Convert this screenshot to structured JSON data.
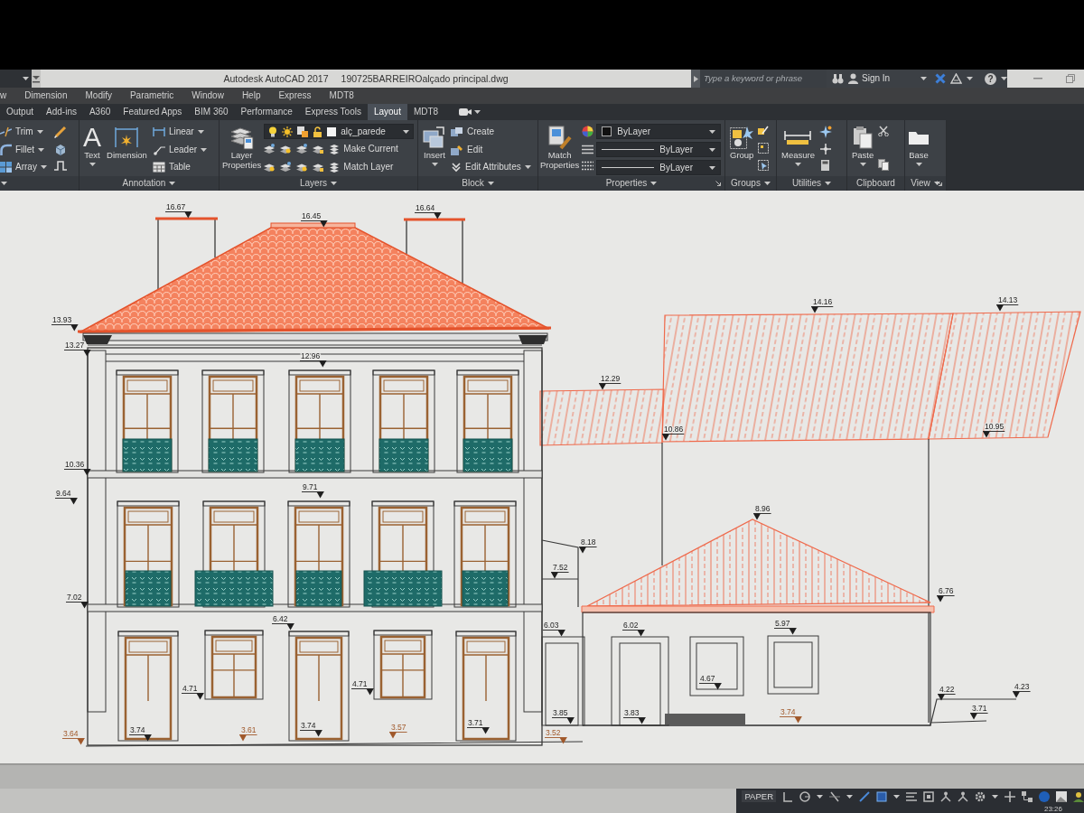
{
  "title_bar": {
    "title": "Autodesk AutoCAD 2017",
    "file_name": "190725BARREIROalçado principal.dwg",
    "search": {
      "placeholder": "Type a keyword or phrase"
    },
    "sign_in": "Sign In",
    "help_glyph": "?"
  },
  "menu_bar": [
    "w",
    "Dimension",
    "Modify",
    "Parametric",
    "Window",
    "Help",
    "Express",
    "MDT8"
  ],
  "ribbon_tabs": [
    {
      "label": "Output",
      "selected": false
    },
    {
      "label": "Add-ins",
      "selected": false
    },
    {
      "label": "A360",
      "selected": false
    },
    {
      "label": "Featured Apps",
      "selected": false
    },
    {
      "label": "BIM 360",
      "selected": false
    },
    {
      "label": "Performance",
      "selected": false
    },
    {
      "label": "Express Tools",
      "selected": false
    },
    {
      "label": "Layout",
      "selected": true
    },
    {
      "label": "MDT8",
      "selected": false
    }
  ],
  "ribbon_panels": [
    {
      "title_menu": true,
      "tools": [
        {
          "kind": "small",
          "label": "Trim",
          "has_menu": true
        },
        {
          "kind": "small",
          "label": "Fillet",
          "has_menu": true
        },
        {
          "kind": "small",
          "label": "Array",
          "has_menu": true
        }
      ]
    },
    {
      "title": "Annotation",
      "title_menu": true,
      "tools": [
        {
          "kind": "large",
          "glyph": "A",
          "label": "Text",
          "has_menu": true
        },
        {
          "kind": "large",
          "label": "Dimension",
          "has_menu": false
        },
        {
          "kind": "small",
          "label": "Linear",
          "has_menu": true
        },
        {
          "kind": "small",
          "label": "Leader",
          "has_menu": true
        },
        {
          "kind": "small",
          "label": "Table",
          "has_menu": false
        }
      ]
    },
    {
      "title": "Layers",
      "title_menu": true,
      "tools": [
        {
          "kind": "large",
          "label": "Layer Properties",
          "has_menu": false
        },
        {
          "kind": "layer_dropdown",
          "value": "alç_parede"
        },
        {
          "kind": "small",
          "label": "Make Current",
          "has_menu": false
        },
        {
          "kind": "small",
          "label": "Match Layer",
          "has_menu": false
        }
      ]
    },
    {
      "title": "Block",
      "title_menu": true,
      "tools": [
        {
          "kind": "large",
          "label": "Insert",
          "has_menu": true
        },
        {
          "kind": "small",
          "label": "Create",
          "has_menu": false
        },
        {
          "kind": "small",
          "label": "Edit",
          "has_menu": false
        },
        {
          "kind": "small",
          "label": "Edit Attributes",
          "has_menu": true
        }
      ]
    },
    {
      "title": "Properties",
      "title_menu": true,
      "launcher": true,
      "tools": [
        {
          "kind": "large",
          "label": "Match Properties",
          "has_menu": false
        },
        {
          "kind": "color_dropdown",
          "value": "ByLayer"
        },
        {
          "kind": "line_dropdown",
          "value": "ByLayer"
        },
        {
          "kind": "line_dropdown",
          "value": "ByLayer"
        }
      ]
    },
    {
      "title": "Groups",
      "title_menu": true,
      "tools": [
        {
          "kind": "large",
          "label": "Group",
          "has_menu": false
        }
      ]
    },
    {
      "title": "Utilities",
      "title_menu": true,
      "tools": [
        {
          "kind": "large",
          "label": "Measure",
          "has_menu": true
        }
      ]
    },
    {
      "title": "Clipboard",
      "title_menu": false,
      "tools": [
        {
          "kind": "large",
          "label": "Paste",
          "has_menu": true
        }
      ]
    },
    {
      "title": "View",
      "title_menu": true,
      "launcher": true,
      "tools": [
        {
          "kind": "large",
          "label": "Base",
          "has_menu": true
        }
      ]
    }
  ],
  "drawing": {
    "level_marks": [
      {
        "text": "16.67",
        "kind": "level"
      },
      {
        "text": "16.45",
        "kind": "level"
      },
      {
        "text": "16.64",
        "kind": "level"
      },
      {
        "text": "13.93",
        "kind": "level"
      },
      {
        "text": "13.27",
        "kind": "level"
      },
      {
        "text": "12.96",
        "kind": "level"
      },
      {
        "text": "10.36",
        "kind": "level"
      },
      {
        "text": "9.64",
        "kind": "level"
      },
      {
        "text": "9.71",
        "kind": "level"
      },
      {
        "text": "7.02",
        "kind": "level"
      },
      {
        "text": "6.42",
        "kind": "level"
      },
      {
        "text": "4.71",
        "kind": "level"
      },
      {
        "text": "4.71",
        "kind": "level"
      },
      {
        "text": "3.74",
        "kind": "level"
      },
      {
        "text": "3.74",
        "kind": "level"
      },
      {
        "text": "3.71",
        "kind": "level"
      },
      {
        "text": "3.64",
        "kind": "ground"
      },
      {
        "text": "3.61",
        "kind": "ground"
      },
      {
        "text": "3.57",
        "kind": "ground"
      },
      {
        "text": "3.52",
        "kind": "ground"
      },
      {
        "text": "3.85",
        "kind": "level"
      },
      {
        "text": "6.03",
        "kind": "level"
      },
      {
        "text": "7.52",
        "kind": "level"
      },
      {
        "text": "8.18",
        "kind": "level"
      },
      {
        "text": "12.29",
        "kind": "level"
      },
      {
        "text": "10.86",
        "kind": "level"
      },
      {
        "text": "14.16",
        "kind": "level"
      },
      {
        "text": "14.13",
        "kind": "level"
      },
      {
        "text": "10.95",
        "kind": "level"
      },
      {
        "text": "8.96",
        "kind": "level"
      },
      {
        "text": "6.76",
        "kind": "level"
      },
      {
        "text": "6.02",
        "kind": "level"
      },
      {
        "text": "5.97",
        "kind": "level"
      },
      {
        "text": "4.67",
        "kind": "level"
      },
      {
        "text": "3.83",
        "kind": "level"
      },
      {
        "text": "3.74",
        "kind": "ground"
      },
      {
        "text": "4.22",
        "kind": "level"
      },
      {
        "text": "4.23",
        "kind": "level"
      },
      {
        "text": "3.71",
        "kind": "level"
      }
    ]
  },
  "status_bar": {
    "space": "PAPER",
    "clock": "23:26"
  }
}
